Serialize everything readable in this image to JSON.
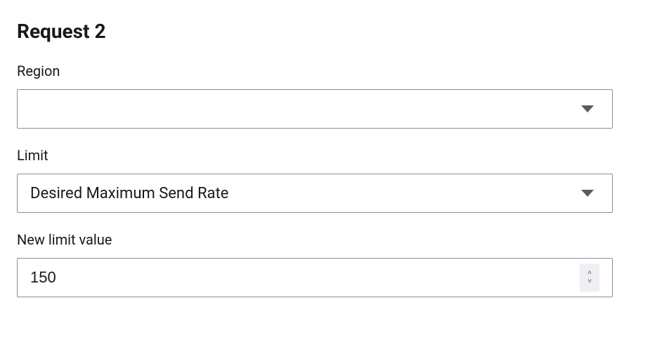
{
  "form": {
    "title": "Request 2",
    "region": {
      "label": "Region",
      "value": ""
    },
    "limit": {
      "label": "Limit",
      "value": "Desired Maximum Send Rate"
    },
    "new_limit": {
      "label": "New limit value",
      "value": "150"
    }
  }
}
